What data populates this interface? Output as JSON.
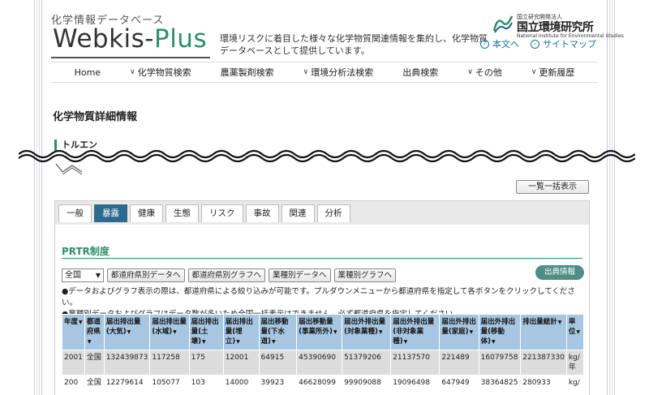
{
  "header": {
    "brand_sub": "化学情報データベース",
    "brand_main_a": "Webkis-",
    "brand_main_b": "Plus",
    "tagline": "環境リスクに着目した様々な化学物質関連情報を集約し、化学物質データベースとして提供しています。",
    "org_small": "国立研究開発法人",
    "org_name": "国立環境研究所",
    "org_en": "National Institute for Environmental Studies",
    "links": [
      {
        "label": "本文へ"
      },
      {
        "label": "サイトマップ"
      }
    ]
  },
  "nav": [
    {
      "label": "Home",
      "has_chevron": false
    },
    {
      "label": "化学物質検索",
      "has_chevron": true
    },
    {
      "label": "農薬製剤検索",
      "has_chevron": false
    },
    {
      "label": "環境分析法検索",
      "has_chevron": true
    },
    {
      "label": "出典検索",
      "has_chevron": false
    },
    {
      "label": "その他",
      "has_chevron": true
    },
    {
      "label": "更新履歴",
      "has_chevron": true
    }
  ],
  "page_title": "化学物質詳細情報",
  "chemical_name": "トルエン",
  "list_button": "一覧一括表示",
  "tabs": [
    {
      "label": "一般",
      "active": false
    },
    {
      "label": "暴露",
      "active": true
    },
    {
      "label": "健康",
      "active": false
    },
    {
      "label": "生態",
      "active": false
    },
    {
      "label": "リスク",
      "active": false
    },
    {
      "label": "事故",
      "active": false
    },
    {
      "label": "関連",
      "active": false
    },
    {
      "label": "分析",
      "active": false
    }
  ],
  "section": {
    "title": "PRTR制度",
    "select_value": "全国",
    "buttons": [
      "都道府県別データへ",
      "都道府県別グラフへ",
      "業種別データへ",
      "業種別グラフへ"
    ],
    "source_button": "出典情報",
    "notes": [
      "●データおよびグラフ表示の際は、都道府県による絞り込みが可能です。プルダウンメニューから都道府県を指定して各ボタンをクリックしてください。",
      "●業種別データおよびグラフはデータ数が多いため全国一括表示はできません。必ず都道府県を指定してください。"
    ]
  },
  "table": {
    "headers": [
      "年度",
      "都道府県",
      "届出排出量(大気)",
      "届出排出量(水域)",
      "届出排出量(土壌)",
      "届出排出量(埋立)",
      "届出移動量(下水道)",
      "届出移動量(事業所外)",
      "届出外排出量(対象業種)",
      "届出外排出量(非対象業種)",
      "届出外排出量(家庭)",
      "届出外排出量(移動体)",
      "排出量総計",
      "単位"
    ],
    "rows": [
      [
        "2001",
        "全国",
        "132439873",
        "117258",
        "175",
        "12001",
        "64915",
        "45390690",
        "51379206",
        "21137570",
        "221489",
        "16079758",
        "221387330",
        "kg/年"
      ],
      [
        "200",
        "全国",
        "12279614",
        "105077",
        "103",
        "14000",
        "39923",
        "46628099",
        "99909088",
        "19096498",
        "647949",
        "38364825",
        "280933",
        "kg/"
      ]
    ]
  },
  "colors": {
    "accent_green": "#2e8f6a",
    "tab_active": "#2c6b8c",
    "table_header": "#a7c6e1",
    "link": "#1a6e9a"
  }
}
